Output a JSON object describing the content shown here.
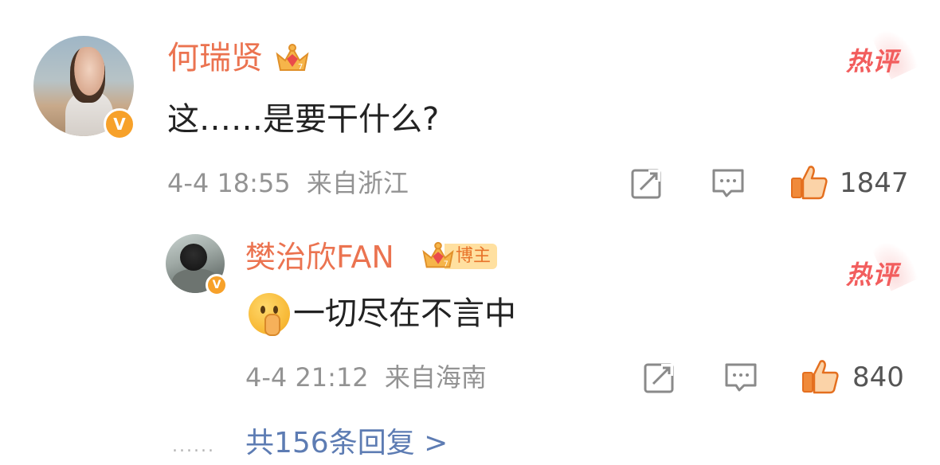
{
  "comment": {
    "username": "何瑞贤",
    "content": "这……是要干什么?",
    "timestamp": "4-4 18:55",
    "location": "来自浙江",
    "like_count": "1847",
    "hot_tag": "热评"
  },
  "reply": {
    "username": "樊治欣FAN",
    "blogger_tag": "博主",
    "content": "一切尽在不言中",
    "timestamp": "4-4 21:12",
    "location": "来自海南",
    "like_count": "840",
    "hot_tag": "热评"
  },
  "more_replies": {
    "dots": "......",
    "label": "共156条回复 >"
  },
  "colors": {
    "username": "#eb7350",
    "hot_tag": "#f25d5d",
    "meta_text": "#939393",
    "link": "#5d7cb3",
    "verified": "#f7a12a",
    "like_icon": "#f08a3a"
  },
  "icons": {
    "repost": "repost-icon",
    "comment": "comment-icon",
    "like": "thumbs-up-icon",
    "verified": "verified-v-icon",
    "crown": "crown-icon",
    "emoji": "shushing-face-emoji"
  }
}
